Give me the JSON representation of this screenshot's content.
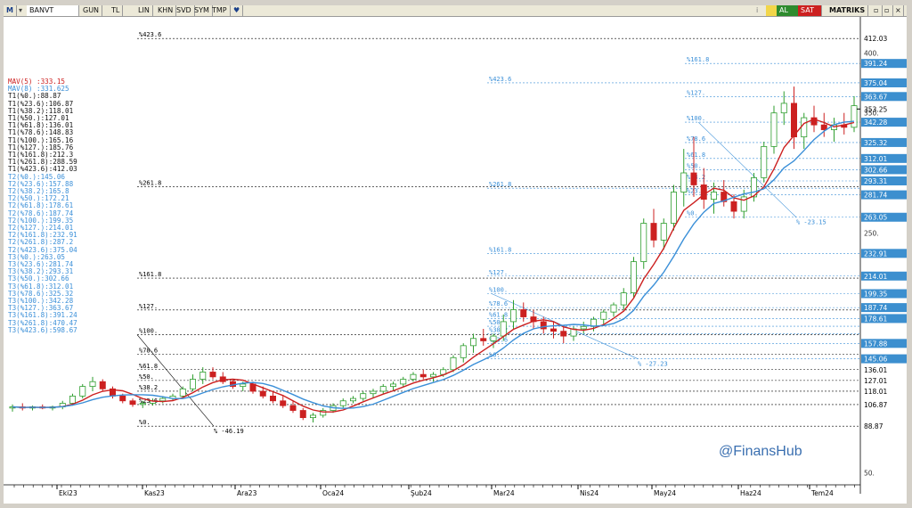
{
  "toolbar": {
    "symbol": "BANVT",
    "icon_left": "m-logo-icon",
    "buttons": [
      "GUN",
      "TL",
      "LIN",
      "KHN",
      "SVD",
      "SYM",
      "TMP"
    ],
    "right_buttons": [
      "AL",
      "SAT",
      "MATRIKS"
    ],
    "colors": {
      "al": "#2e8b2e",
      "sat": "#cc2020"
    }
  },
  "watermark": "@FinansHub",
  "chart_data": {
    "type": "candlestick",
    "symbol": "BANVT",
    "ylim": [
      40,
      430
    ],
    "price_axis_labels": [
      {
        "v": 412.03,
        "hl": false
      },
      {
        "v": 391.24,
        "hl": true
      },
      {
        "v": 375.04,
        "hl": true
      },
      {
        "v": 363.67,
        "hl": true
      },
      {
        "v": 353.25,
        "hl": false
      },
      {
        "v": 342.28,
        "hl": true
      },
      {
        "v": 325.32,
        "hl": true
      },
      {
        "v": 312.01,
        "hl": true
      },
      {
        "v": 302.66,
        "hl": true
      },
      {
        "v": 293.31,
        "hl": true
      },
      {
        "v": 281.74,
        "hl": true
      },
      {
        "v": 263.05,
        "hl": true
      },
      {
        "v": 232.91,
        "hl": true
      },
      {
        "v": 214.01,
        "hl": true
      },
      {
        "v": 199.35,
        "hl": true
      },
      {
        "v": 187.74,
        "hl": true
      },
      {
        "v": 178.61,
        "hl": true
      },
      {
        "v": 157.88,
        "hl": true
      },
      {
        "v": 145.06,
        "hl": true
      },
      {
        "v": 136.01,
        "hl": false
      },
      {
        "v": 127.01,
        "hl": false
      },
      {
        "v": 118.01,
        "hl": false
      },
      {
        "v": 106.87,
        "hl": false
      },
      {
        "v": 88.87,
        "hl": false
      }
    ],
    "axis_ticks": [
      "400.",
      "350.",
      "250.",
      "50."
    ],
    "x_labels": [
      "Eki23",
      "Kas23",
      "Ara23",
      "Oca24",
      "Şub24",
      "Mar24",
      "Nis24",
      "May24",
      "Haz24",
      "Tem24"
    ],
    "indicators": [
      {
        "name": "MAV(5)",
        "value": "333.15",
        "color": "#cc2020"
      },
      {
        "name": "MAV(8)",
        "value": "331.625",
        "color": "#3a8fd8"
      }
    ],
    "fib_sets": [
      {
        "id": "T1",
        "color": "#000000",
        "levels": [
          {
            "pct": "%0.",
            "v": "88.87"
          },
          {
            "pct": "%23.6",
            "v": "106.87"
          },
          {
            "pct": "%38.2",
            "v": "118.01"
          },
          {
            "pct": "%50.",
            "v": "127.01"
          },
          {
            "pct": "%61.8",
            "v": "136.01"
          },
          {
            "pct": "%78.6",
            "v": "148.83"
          },
          {
            "pct": "%100.",
            "v": "165.16"
          },
          {
            "pct": "%127.",
            "v": "185.76"
          },
          {
            "pct": "%161.8",
            "v": "212.3"
          },
          {
            "pct": "%261.8",
            "v": "288.59"
          },
          {
            "pct": "%423.6",
            "v": "412.03"
          }
        ]
      },
      {
        "id": "T2",
        "color": "#3a8fd8",
        "levels": [
          {
            "pct": "%0.",
            "v": "145.06"
          },
          {
            "pct": "%23.6",
            "v": "157.88"
          },
          {
            "pct": "%38.2",
            "v": "165.8"
          },
          {
            "pct": "%50.",
            "v": "172.21"
          },
          {
            "pct": "%61.8",
            "v": "178.61"
          },
          {
            "pct": "%78.6",
            "v": "187.74"
          },
          {
            "pct": "%100.",
            "v": "199.35"
          },
          {
            "pct": "%127.",
            "v": "214.01"
          },
          {
            "pct": "%161.8",
            "v": "232.91"
          },
          {
            "pct": "%261.8",
            "v": "287.2"
          },
          {
            "pct": "%423.6",
            "v": "375.04"
          }
        ]
      },
      {
        "id": "T3",
        "color": "#3a8fd8",
        "levels": [
          {
            "pct": "%0.",
            "v": "263.05"
          },
          {
            "pct": "%23.6",
            "v": "281.74"
          },
          {
            "pct": "%38.2",
            "v": "293.31"
          },
          {
            "pct": "%50.",
            "v": "302.66"
          },
          {
            "pct": "%61.8",
            "v": "312.01"
          },
          {
            "pct": "%78.6",
            "v": "325.32"
          },
          {
            "pct": "%100.",
            "v": "342.28"
          },
          {
            "pct": "%127.",
            "v": "363.67"
          },
          {
            "pct": "%161.8",
            "v": "391.24"
          },
          {
            "pct": "%261.8",
            "v": "470.47"
          },
          {
            "pct": "%423.6",
            "v": "598.67"
          }
        ]
      }
    ],
    "trend_labels": [
      "% -46.19",
      "% -27.23",
      "% -23.15"
    ],
    "ohlc": [
      [
        104,
        107,
        101,
        105
      ],
      [
        105,
        108,
        102,
        104
      ],
      [
        104,
        106,
        102,
        105
      ],
      [
        105,
        107,
        103,
        104
      ],
      [
        104,
        106,
        102,
        105
      ],
      [
        105,
        110,
        103,
        108
      ],
      [
        108,
        116,
        106,
        114
      ],
      [
        114,
        124,
        112,
        122
      ],
      [
        122,
        130,
        118,
        126
      ],
      [
        126,
        128,
        118,
        120
      ],
      [
        120,
        122,
        112,
        114
      ],
      [
        114,
        116,
        108,
        110
      ],
      [
        110,
        112,
        105,
        107
      ],
      [
        107,
        110,
        104,
        108
      ],
      [
        108,
        112,
        106,
        110
      ],
      [
        110,
        114,
        108,
        112
      ],
      [
        112,
        116,
        110,
        114
      ],
      [
        114,
        122,
        112,
        120
      ],
      [
        120,
        132,
        118,
        128
      ],
      [
        128,
        138,
        124,
        134
      ],
      [
        134,
        138,
        128,
        130
      ],
      [
        130,
        134,
        124,
        126
      ],
      [
        126,
        128,
        120,
        122
      ],
      [
        122,
        126,
        118,
        124
      ],
      [
        124,
        126,
        116,
        118
      ],
      [
        118,
        122,
        112,
        114
      ],
      [
        114,
        118,
        108,
        110
      ],
      [
        110,
        114,
        104,
        106
      ],
      [
        106,
        110,
        100,
        102
      ],
      [
        102,
        104,
        94,
        96
      ],
      [
        96,
        100,
        92,
        98
      ],
      [
        98,
        104,
        96,
        102
      ],
      [
        102,
        108,
        100,
        106
      ],
      [
        106,
        112,
        104,
        110
      ],
      [
        110,
        114,
        108,
        112
      ],
      [
        112,
        118,
        110,
        116
      ],
      [
        116,
        120,
        112,
        118
      ],
      [
        118,
        124,
        116,
        122
      ],
      [
        122,
        126,
        118,
        124
      ],
      [
        124,
        130,
        122,
        128
      ],
      [
        128,
        134,
        126,
        132
      ],
      [
        132,
        136,
        128,
        130
      ],
      [
        130,
        134,
        126,
        132
      ],
      [
        132,
        138,
        130,
        136
      ],
      [
        136,
        148,
        134,
        146
      ],
      [
        146,
        158,
        142,
        156
      ],
      [
        156,
        166,
        150,
        162
      ],
      [
        162,
        170,
        156,
        160
      ],
      [
        160,
        166,
        154,
        164
      ],
      [
        164,
        182,
        160,
        176
      ],
      [
        176,
        194,
        170,
        186
      ],
      [
        186,
        192,
        176,
        180
      ],
      [
        180,
        186,
        170,
        176
      ],
      [
        176,
        180,
        166,
        170
      ],
      [
        170,
        176,
        162,
        168
      ],
      [
        168,
        172,
        158,
        164
      ],
      [
        164,
        172,
        160,
        170
      ],
      [
        170,
        176,
        166,
        172
      ],
      [
        172,
        180,
        168,
        178
      ],
      [
        178,
        186,
        174,
        184
      ],
      [
        184,
        192,
        180,
        190
      ],
      [
        190,
        204,
        186,
        200
      ],
      [
        200,
        230,
        196,
        226
      ],
      [
        226,
        262,
        220,
        258
      ],
      [
        258,
        270,
        238,
        244
      ],
      [
        244,
        262,
        236,
        258
      ],
      [
        258,
        290,
        252,
        284
      ],
      [
        284,
        320,
        272,
        300
      ],
      [
        300,
        330,
        280,
        290
      ],
      [
        290,
        304,
        270,
        278
      ],
      [
        278,
        292,
        266,
        284
      ],
      [
        284,
        294,
        272,
        276
      ],
      [
        276,
        282,
        262,
        268
      ],
      [
        268,
        286,
        262,
        280
      ],
      [
        280,
        300,
        276,
        296
      ],
      [
        296,
        326,
        292,
        322
      ],
      [
        322,
        356,
        316,
        350
      ],
      [
        350,
        368,
        340,
        358
      ],
      [
        358,
        372,
        320,
        330
      ],
      [
        330,
        350,
        320,
        346
      ],
      [
        346,
        356,
        334,
        340
      ],
      [
        340,
        350,
        330,
        336
      ],
      [
        336,
        346,
        326,
        340
      ],
      [
        340,
        350,
        332,
        338
      ],
      [
        338,
        364,
        334,
        356
      ]
    ]
  }
}
